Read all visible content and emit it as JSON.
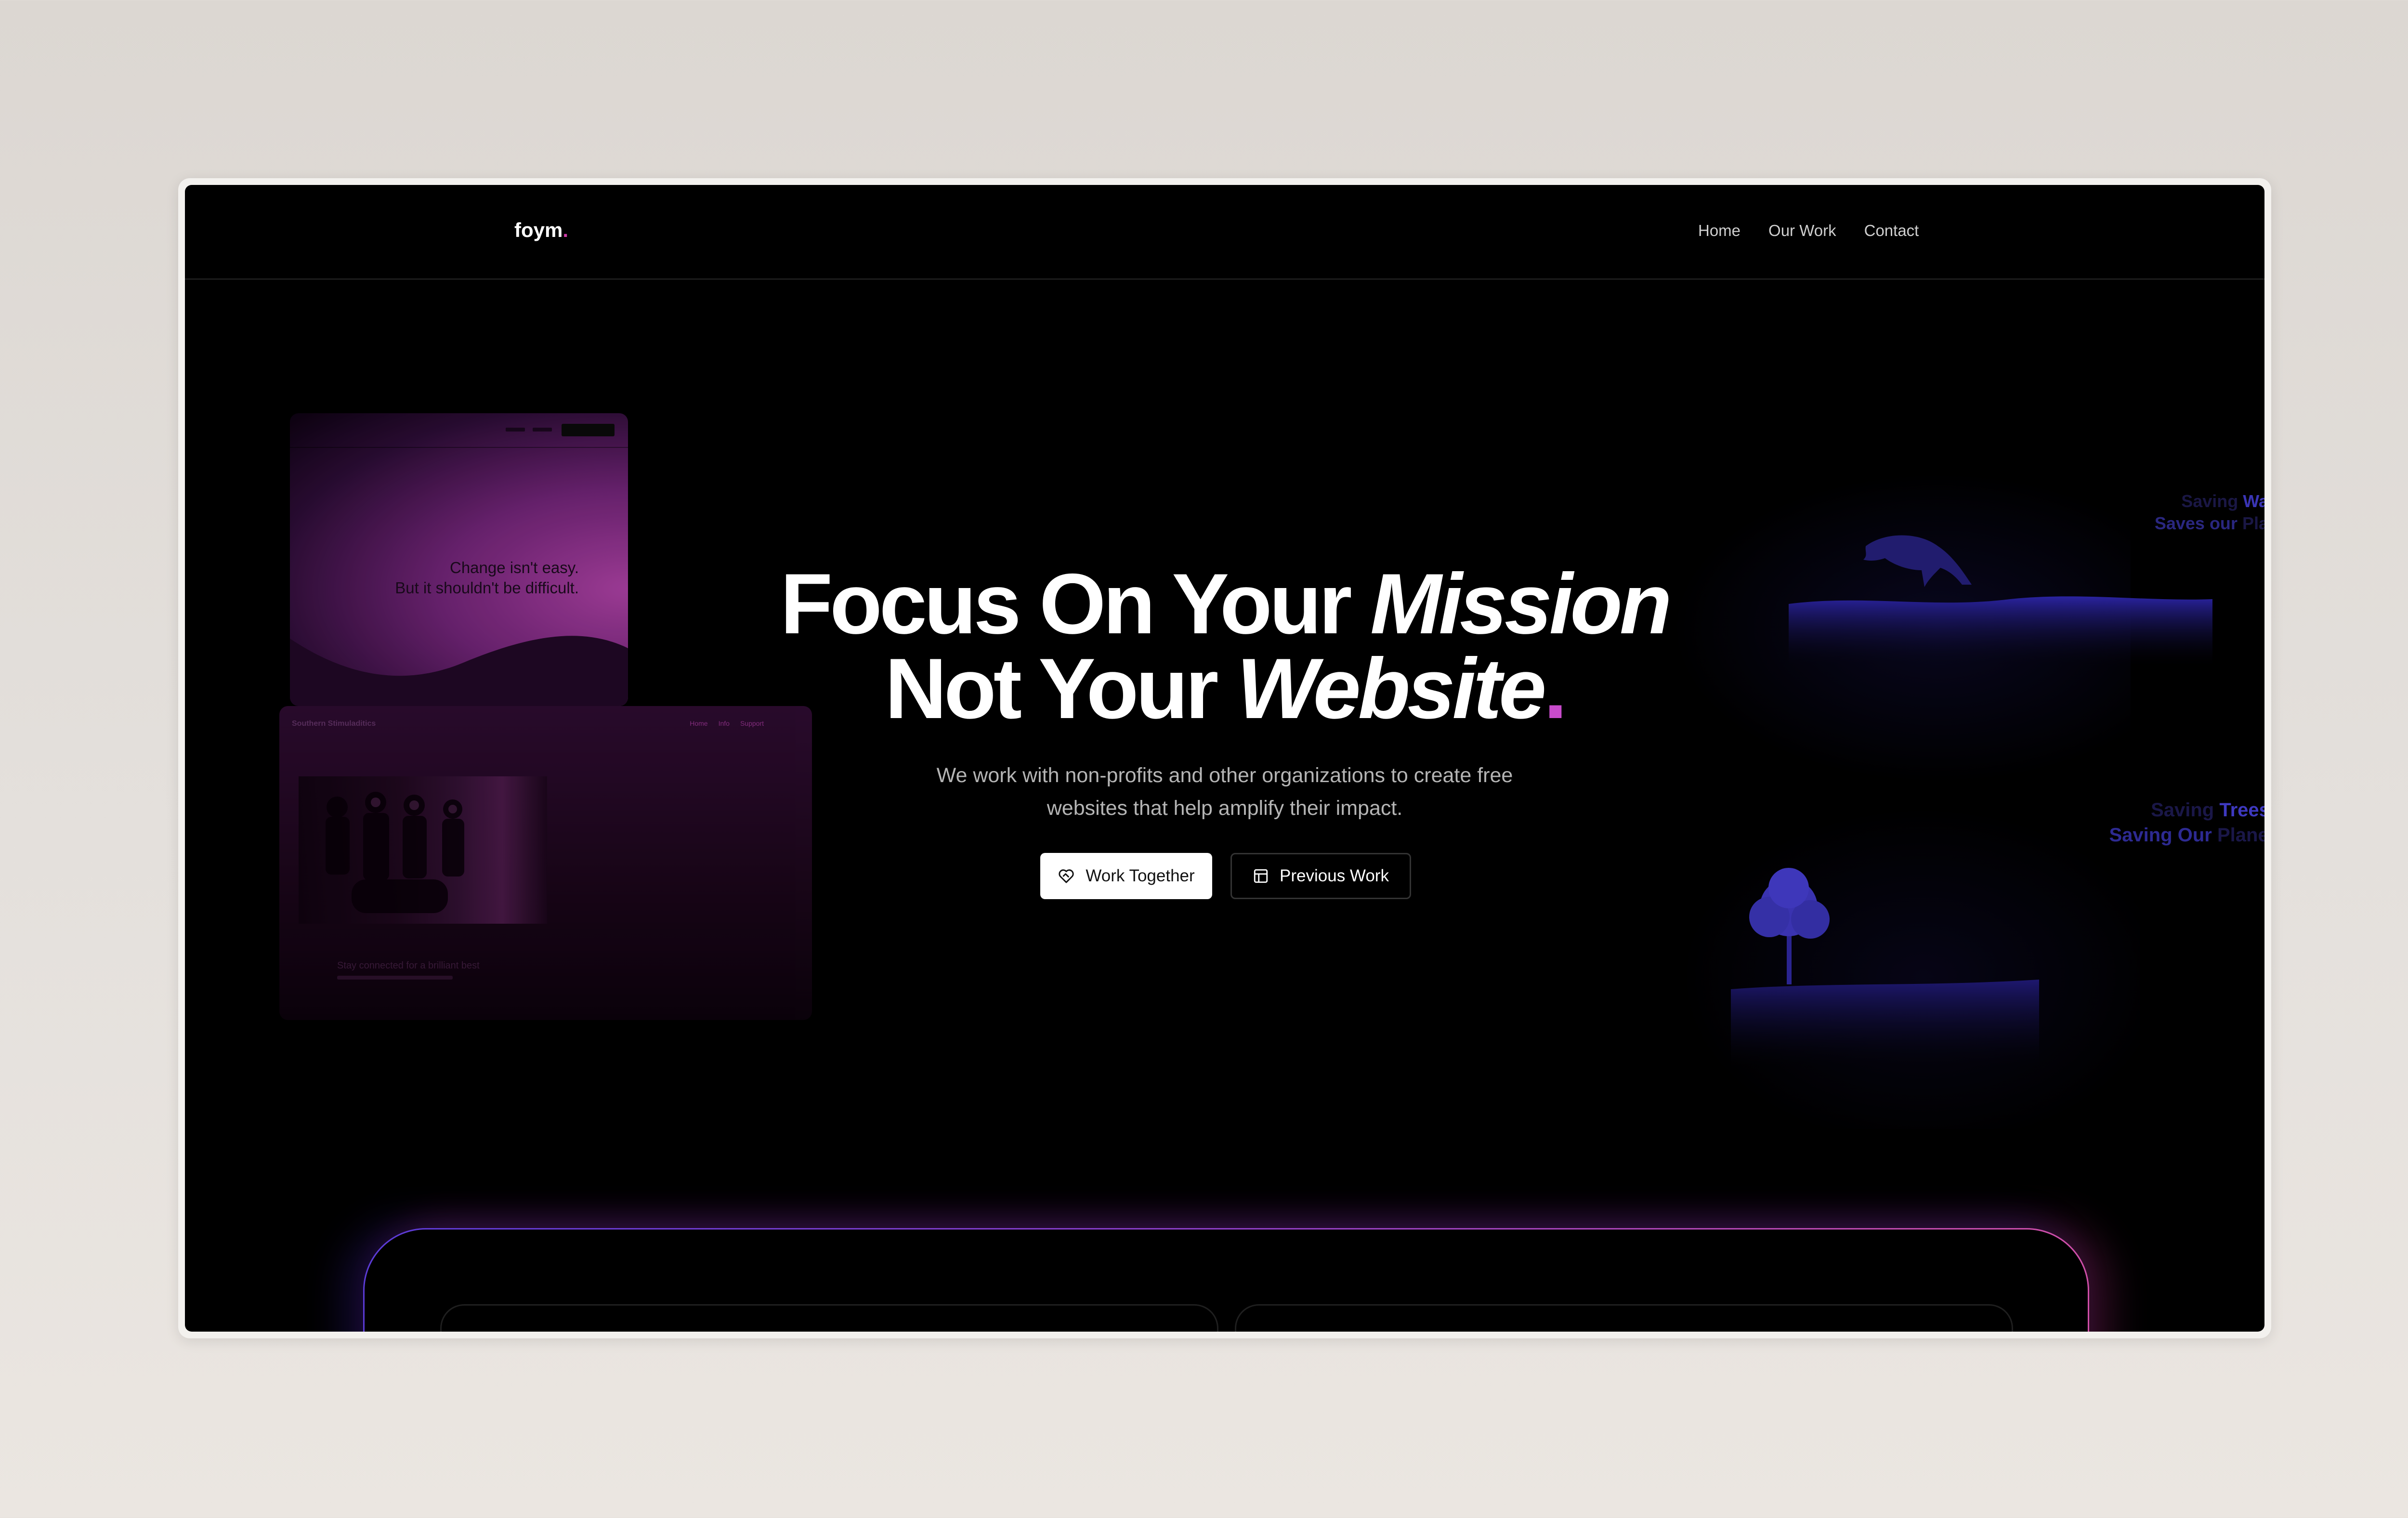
{
  "brand": {
    "name": "foym",
    "dot": "."
  },
  "nav": {
    "items": [
      "Home",
      "Our Work",
      "Contact"
    ]
  },
  "hero": {
    "line1_plain": "Focus On Your ",
    "line1_italic": "Mission",
    "line2_plain": "Not Your ",
    "line2_italic": "Website",
    "line2_dot": ".",
    "subtitle": "We work with non-profits and other organizations to create free websites that help amplify their impact."
  },
  "buttons": {
    "work_together": "Work Together",
    "previous_work": "Previous Work"
  },
  "showcase": {
    "mock1_line1": "Change isn't easy.",
    "mock1_line2": "But it shouldn't be difficult.",
    "mock2_brand": "Southern Stimuladitics",
    "mock2_links": [
      "Home",
      "Info",
      "Support"
    ],
    "mock2_caption": "Stay connected for a brilliant best",
    "eco1_part1": "Saving",
    "eco1_part2": "Water.",
    "eco1_part3": "Saves our",
    "eco1_part4": "Planet",
    "eco2_part1": "Saving",
    "eco2_part2": "Trees.",
    "eco2_part3": "Saving Our",
    "eco2_part4": "Planet"
  },
  "colors": {
    "accent_pink": "#d03ca9",
    "accent_purple": "#c84bcb",
    "indigo": "#3a35b5",
    "background": "#000000"
  }
}
